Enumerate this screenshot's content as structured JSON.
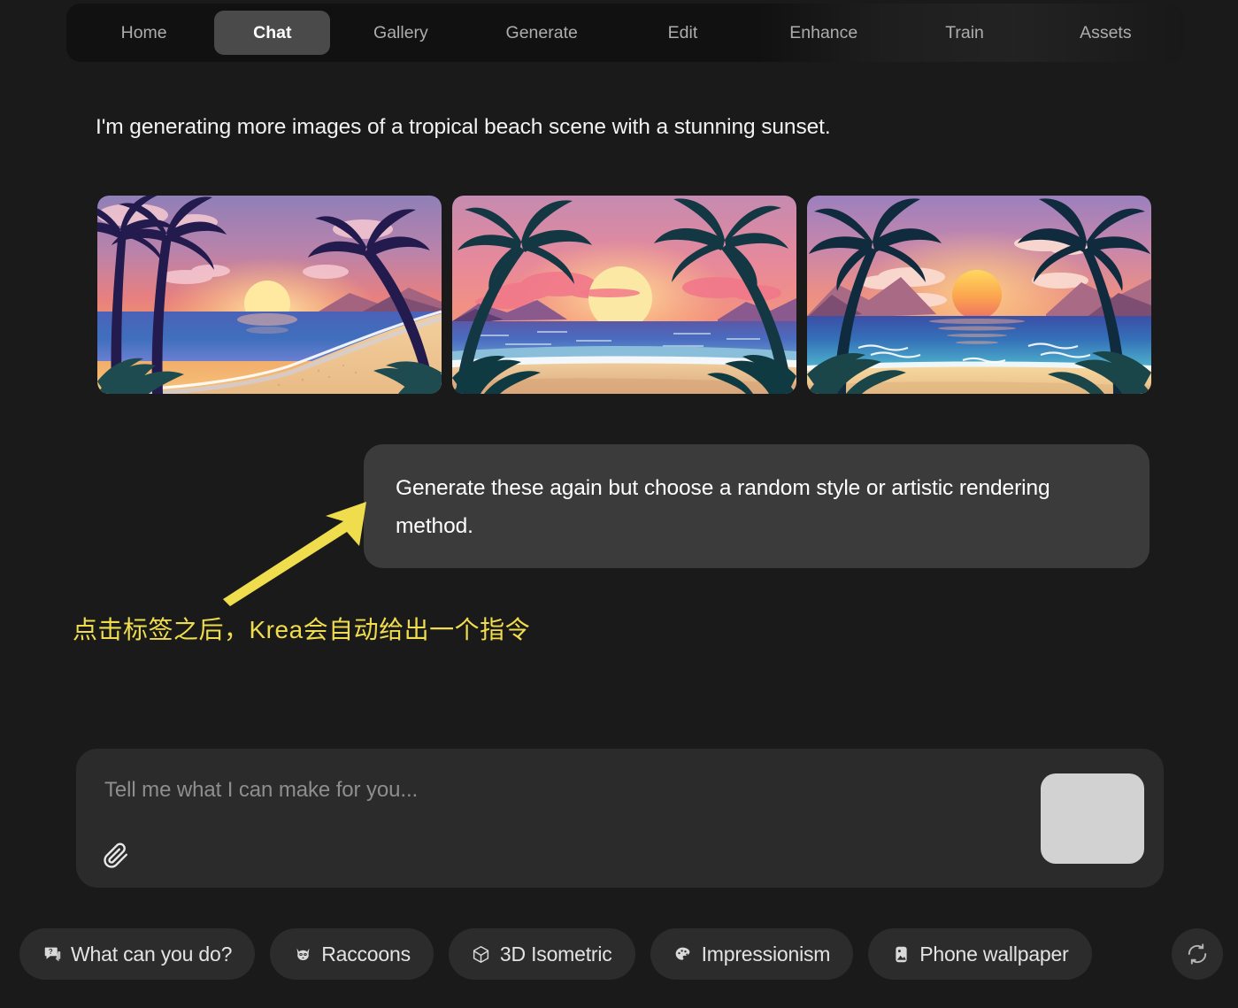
{
  "nav": {
    "tabs": [
      {
        "label": "Home",
        "active": false
      },
      {
        "label": "Chat",
        "active": true
      },
      {
        "label": "Gallery",
        "active": false
      },
      {
        "label": "Generate",
        "active": false
      },
      {
        "label": "Edit",
        "active": false
      },
      {
        "label": "Enhance",
        "active": false
      },
      {
        "label": "Train",
        "active": false
      },
      {
        "label": "Assets",
        "active": false
      }
    ]
  },
  "conversation": {
    "assistant_message": "I'm generating more images of a tropical beach scene with a stunning sunset.",
    "user_message": "Generate these again but choose a random style or artistic rendering method.",
    "images": [
      {
        "alt": "tropical beach sunset with curving shoreline and palm trees on left",
        "name": "generated-image-1"
      },
      {
        "alt": "tropical beach sunset framed by two palm trees with pink clouds",
        "name": "generated-image-2"
      },
      {
        "alt": "tropical beach sunset with orange sun over calm blue sea",
        "name": "generated-image-3"
      }
    ]
  },
  "annotation": {
    "text": "点击标签之后，Krea会自动给出一个指令",
    "color": "#f0dd4e"
  },
  "composer": {
    "placeholder": "Tell me what I can make for you...",
    "value": "",
    "attach_icon": "paperclip-icon",
    "send_icon": "send-button",
    "send_color": "#d2d2d2"
  },
  "suggestions": {
    "chips": [
      {
        "label": "What can you do?",
        "icon": "question-bubble-icon",
        "name": "chip-what-can-you-do"
      },
      {
        "label": "Raccoons",
        "icon": "raccoon-icon",
        "name": "chip-raccoons"
      },
      {
        "label": "3D Isometric",
        "icon": "cube-icon",
        "name": "chip-3d-isometric"
      },
      {
        "label": "Impressionism",
        "icon": "palette-icon",
        "name": "chip-impressionism"
      },
      {
        "label": "Phone wallpaper",
        "icon": "phone-image-icon",
        "name": "chip-phone-wallpaper"
      }
    ],
    "refresh_icon": "refresh-icon"
  },
  "theme": {
    "background": "#1a1a1a",
    "nav_background": "#111111",
    "active_tab": "#4a4a4a",
    "bubble": "#3b3b3b",
    "composer": "#2b2b2b",
    "chip": "#2c2c2c"
  }
}
